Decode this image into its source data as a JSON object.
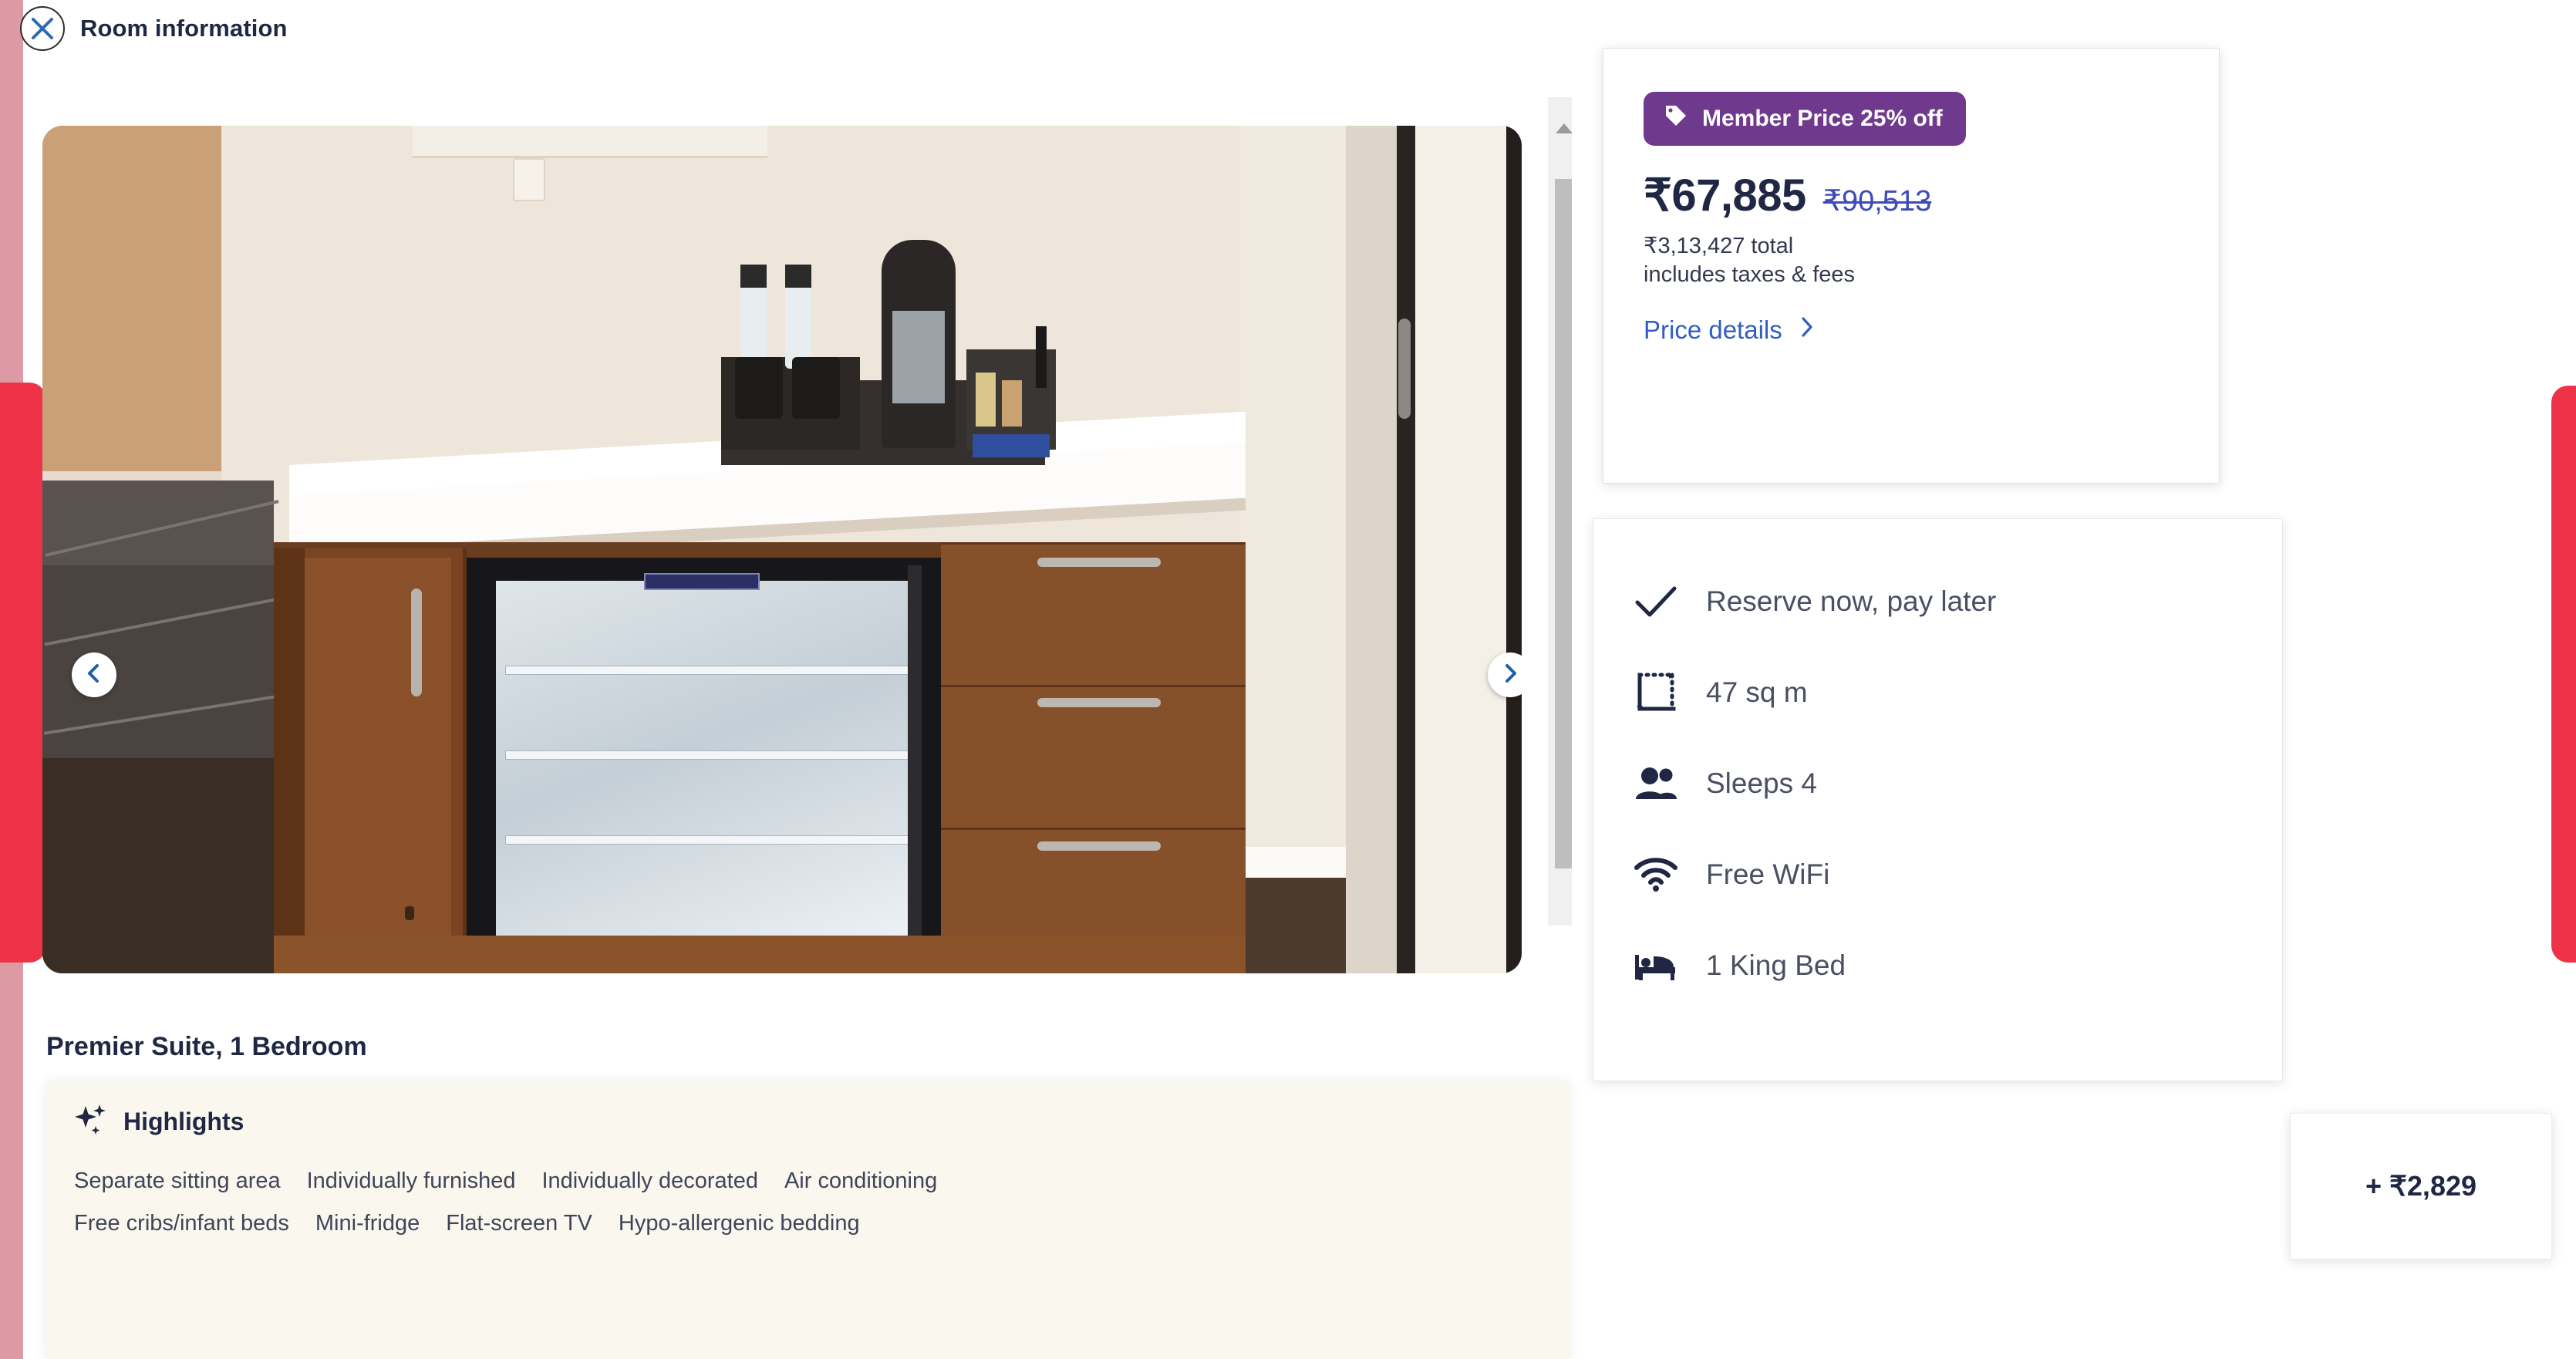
{
  "header": {
    "close_icon": "close-icon",
    "title": "Room information"
  },
  "carousel": {
    "prev_icon": "chevron-left-icon",
    "next_icon": "chevron-right-icon",
    "image_alt": "Hotel room mini-bar with coffee maker, water bottles and open mini-fridge"
  },
  "room": {
    "title": "Premier Suite, 1 Bedroom"
  },
  "highlights": {
    "icon": "sparkle-icon",
    "heading": "Highlights",
    "rows": [
      [
        "Separate sitting area",
        "Individually furnished",
        "Individually decorated",
        "Air conditioning"
      ],
      [
        "Free cribs/infant beds",
        "Mini-fridge",
        "Flat-screen TV",
        "Hypo-allergenic bedding"
      ]
    ]
  },
  "price": {
    "badge_icon": "tag-icon",
    "badge_label": "Member Price 25% off",
    "current": "₹67,885",
    "strikethrough": "₹90,513",
    "total": "₹3,13,427 total",
    "taxes_note": "includes taxes & fees",
    "details_label": "Price details",
    "details_chevron_icon": "chevron-right-icon",
    "badge_color": "#6f3a8e",
    "link_color": "#2f5fc2"
  },
  "amenities": [
    {
      "icon": "check-icon",
      "label": "Reserve now, pay later"
    },
    {
      "icon": "area-icon",
      "label": "47 sq m"
    },
    {
      "icon": "people-icon",
      "label": "Sleeps 4"
    },
    {
      "icon": "wifi-icon",
      "label": "Free WiFi"
    },
    {
      "icon": "bed-icon",
      "label": "1 King Bed"
    }
  ],
  "addon": {
    "label": "+ ₹2,829"
  },
  "accents": {
    "red_bar": "#ee3248",
    "pink_strip": "#dd9aa4",
    "highlights_bg": "#faf7ee"
  }
}
